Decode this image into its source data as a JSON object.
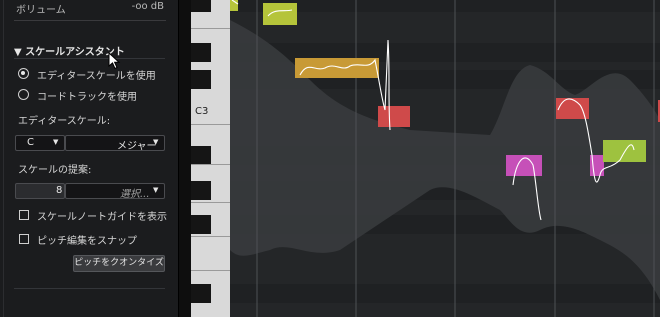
{
  "panel": {
    "volume": {
      "label": "ボリューム",
      "value": "-oo dB"
    },
    "section_title": "▼ スケールアシスタント",
    "radio_editor_scale": "エディタースケールを使用",
    "radio_chord_track": "コードトラックを使用",
    "editor_scale_label": "エディタースケール:",
    "scale_root": "C",
    "scale_type": "メジャー",
    "suggest_label": "スケールの提案:",
    "suggest_value": "8",
    "suggest_select": "選択...",
    "checkbox_guide": "スケールノートガイドを表示",
    "checkbox_snap": "ピッチ編集をスナップ",
    "quantize_button": "ピッチをクオンタイズ"
  },
  "editor": {
    "key_label": "C3"
  },
  "colors": {
    "yellow_green": "#b5c43a",
    "orange": "#c89a36",
    "red": "#cf4a4a",
    "magenta": "#c650b8",
    "green": "#9ec23f"
  }
}
